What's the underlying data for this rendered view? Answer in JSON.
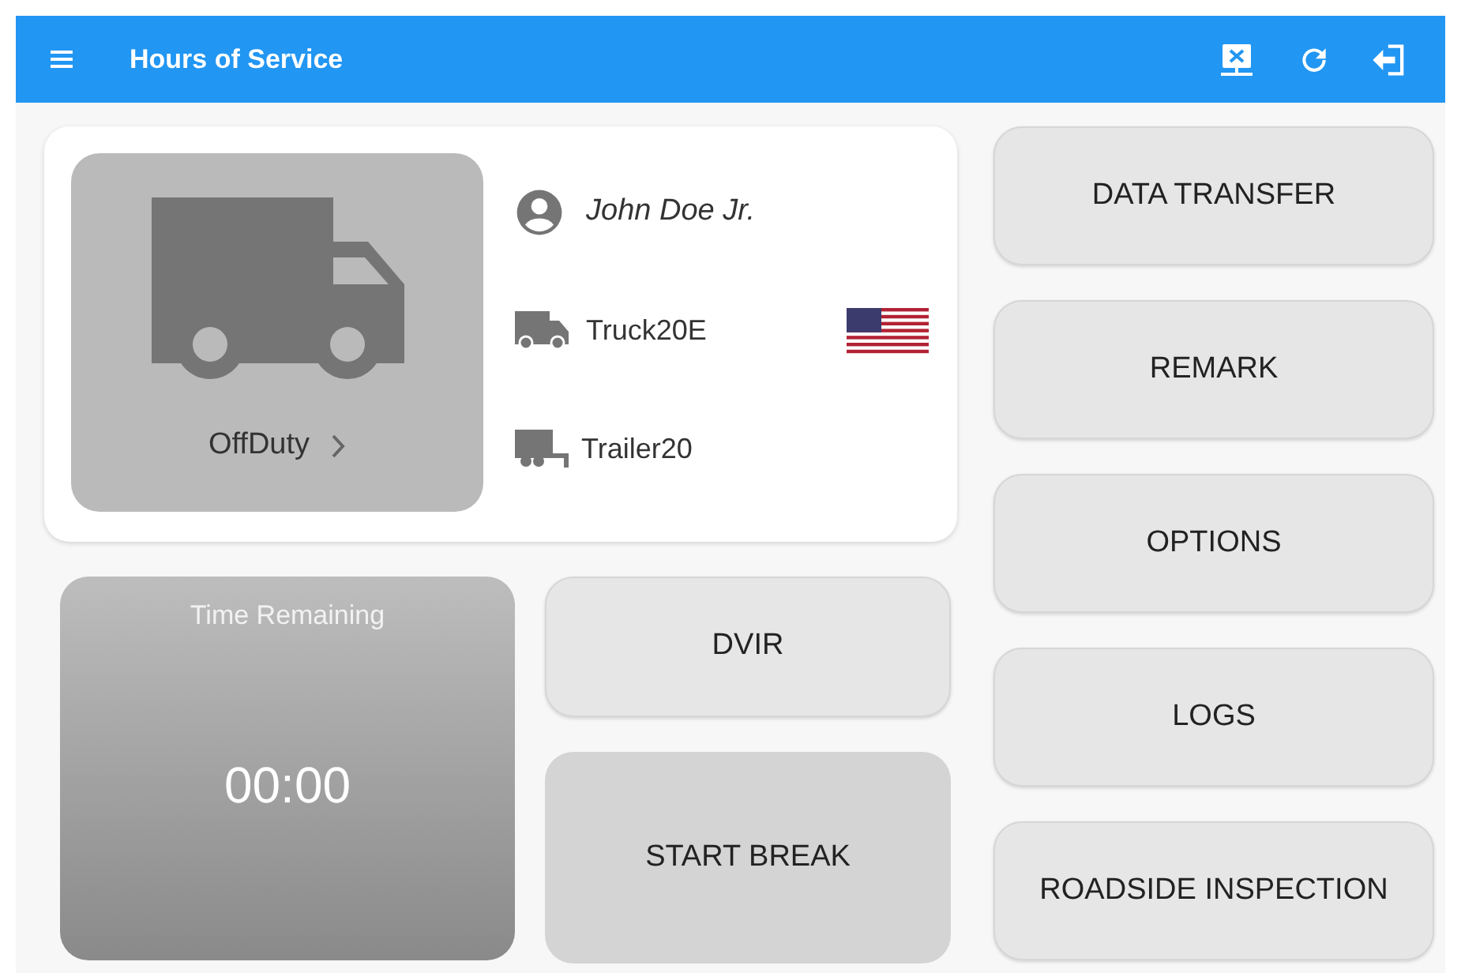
{
  "app_bar": {
    "title": "Hours of Service"
  },
  "status": {
    "label": "OffDuty"
  },
  "driver": {
    "name": "John Doe Jr."
  },
  "vehicle": {
    "truck": "Truck20E",
    "trailer": "Trailer20"
  },
  "timer": {
    "label": "Time Remaining",
    "value": "00:00"
  },
  "actions": [
    "DVIR",
    "START BREAK"
  ],
  "menu_buttons": [
    "DATA TRANSFER",
    "REMARK",
    "OPTIONS",
    "LOGS",
    "ROADSIDE INSPECTION"
  ]
}
